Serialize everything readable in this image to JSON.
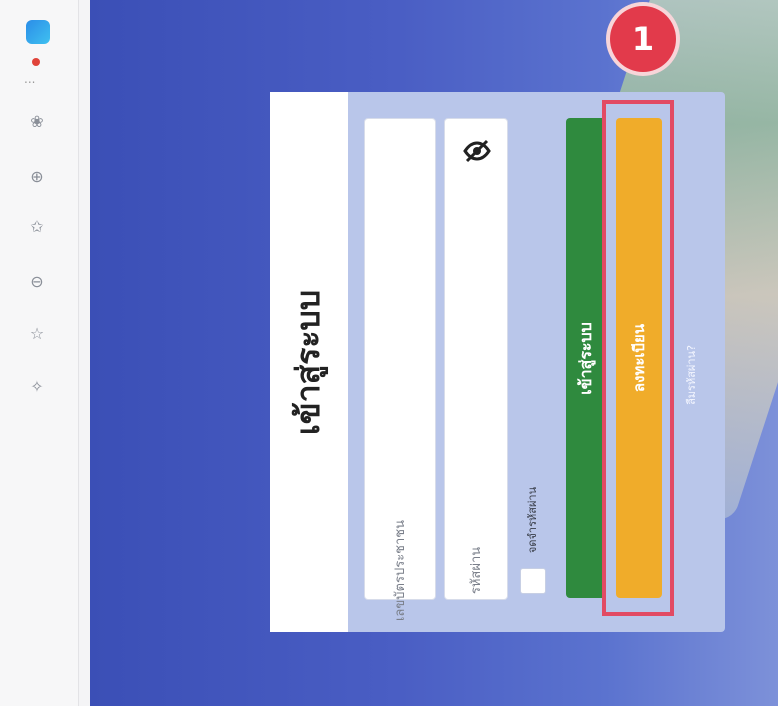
{
  "browser_sidebar": {
    "icons": [
      "edge-logo-icon",
      "notification-dot-icon",
      "more-dots-icon",
      "shopping-icon",
      "copilot-icon",
      "tabs-icon",
      "favorites-icon",
      "collections-icon",
      "star-icon",
      "settings-icon"
    ],
    "more_label": "..."
  },
  "login": {
    "title": "เข้าสู่ระบบ",
    "id_placeholder": "เลขบัตรประชาชน",
    "password_placeholder": "รหัสผ่าน",
    "remember_label": "จดจำรหัสผ่าน",
    "login_button": "เข้าสู่ระบบ",
    "register_button": "ลงทะเบียน",
    "forgot_link": "ลืมรหัสผ่าน?"
  },
  "annotation": {
    "step_number": "1",
    "highlight_color": "#e24a64"
  },
  "colors": {
    "panel": "#b9c6ea",
    "login_green": "#2f8a3e",
    "register_orange": "#f0ac2a",
    "background_blue": "#4a5ec4"
  }
}
